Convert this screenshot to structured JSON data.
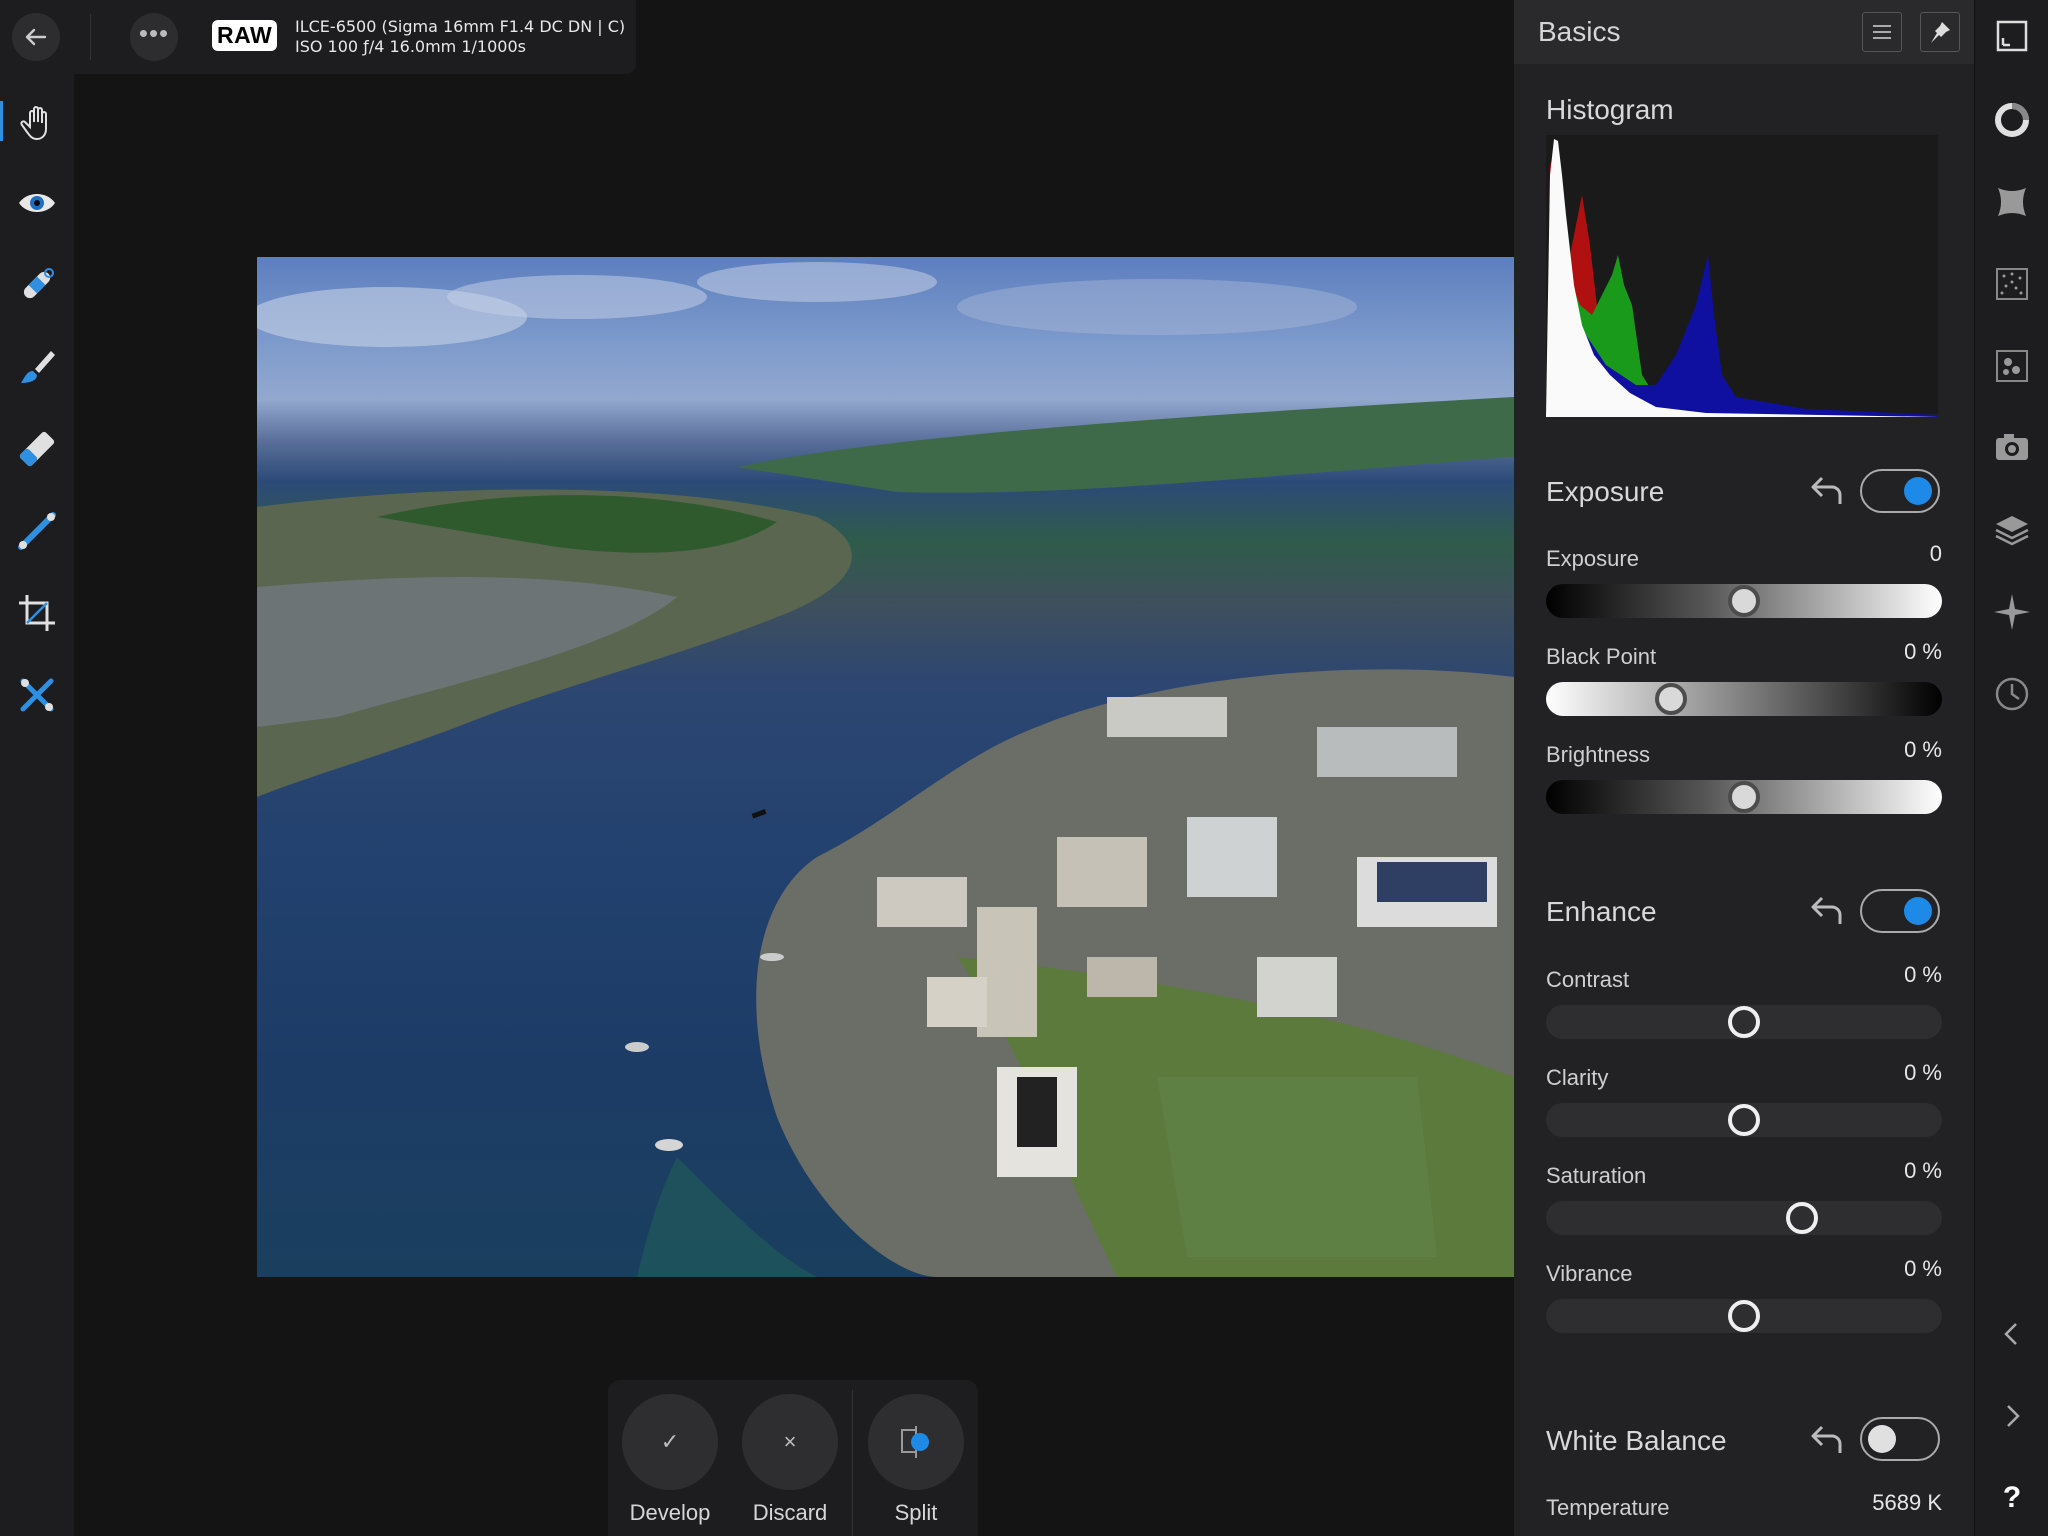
{
  "topbar": {
    "raw_badge": "RAW",
    "camera_line": "ILCE-6500 (Sigma 16mm F1.4 DC DN | C)",
    "exif_line": "ISO 100 ƒ/4 16.0mm 1/1000s"
  },
  "left_tools": [
    "hand-tool",
    "red-eye-tool",
    "blemish-tool",
    "brush-tool",
    "eraser-tool",
    "gradient-tool",
    "crop-tool",
    "overlay-tool"
  ],
  "actions": {
    "develop": {
      "icon": "✓",
      "label": "Develop"
    },
    "discard": {
      "icon": "×",
      "label": "Discard"
    },
    "split": {
      "label": "Split"
    }
  },
  "panel": {
    "title": "Basics",
    "histogram_title": "Histogram",
    "exposure": {
      "title": "Exposure",
      "enabled": true,
      "sliders": [
        {
          "label": "Exposure",
          "value": "0",
          "level": 0.5
        },
        {
          "label": "Black Point",
          "value": "0 %",
          "level": 0.3
        },
        {
          "label": "Brightness",
          "value": "0 %",
          "level": 0.5
        }
      ]
    },
    "enhance": {
      "title": "Enhance",
      "enabled": true,
      "sliders": [
        {
          "label": "Contrast",
          "value": "0 %",
          "level": 0.5
        },
        {
          "label": "Clarity",
          "value": "0 %",
          "level": 0.5
        },
        {
          "label": "Saturation",
          "value": "0 %",
          "level": 0.66
        },
        {
          "label": "Vibrance",
          "value": "0 %",
          "level": 0.5
        }
      ]
    },
    "white_balance": {
      "title": "White Balance",
      "enabled": false,
      "temperature_label": "Temperature",
      "temperature_value": "5689 K"
    }
  },
  "right_rail": {
    "help": "?"
  },
  "colors": {
    "accent": "#1e8ae8",
    "panel": "#222224",
    "background": "#141414"
  }
}
